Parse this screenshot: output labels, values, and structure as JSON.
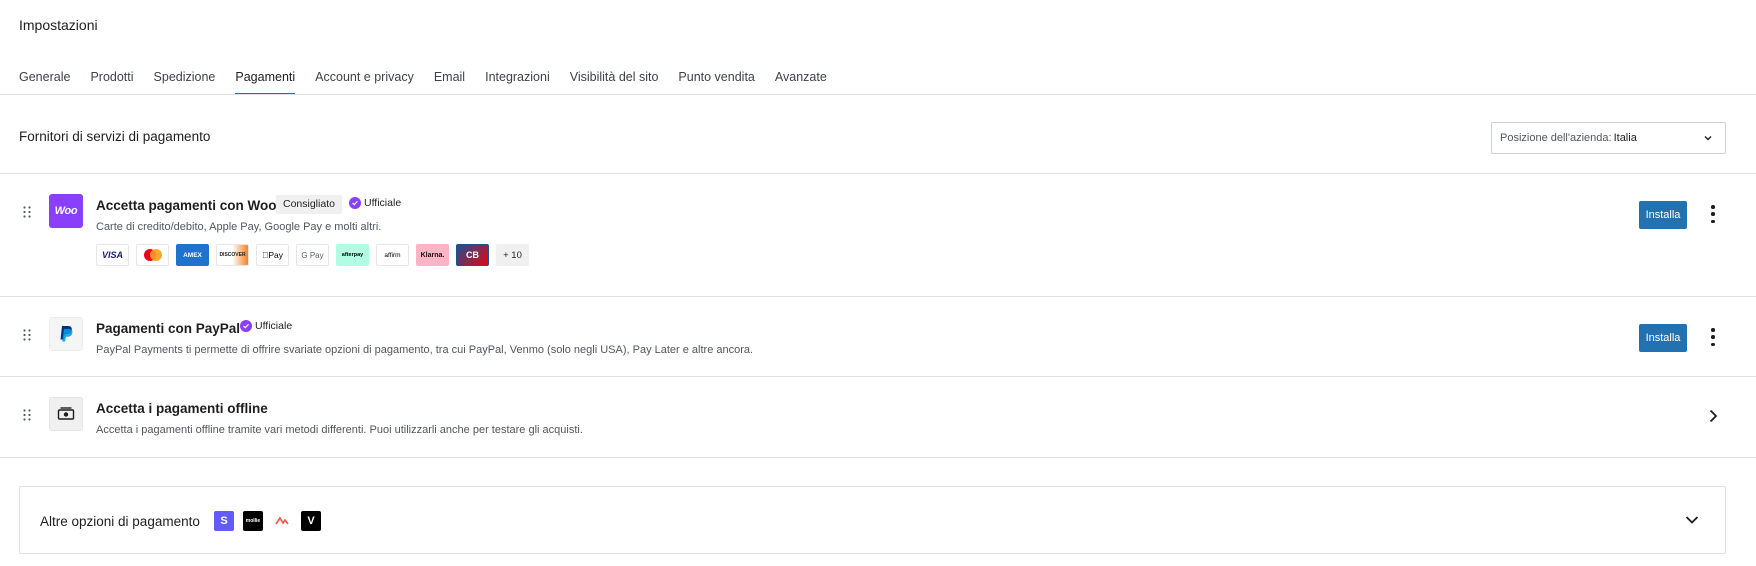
{
  "page": {
    "title": "Impostazioni"
  },
  "tabs": [
    {
      "label": "Generale",
      "active": false
    },
    {
      "label": "Prodotti",
      "active": false
    },
    {
      "label": "Spedizione",
      "active": false
    },
    {
      "label": "Pagamenti",
      "active": true
    },
    {
      "label": "Account e privacy",
      "active": false
    },
    {
      "label": "Email",
      "active": false
    },
    {
      "label": "Integrazioni",
      "active": false
    },
    {
      "label": "Visibilità del sito",
      "active": false
    },
    {
      "label": "Punto vendita",
      "active": false
    },
    {
      "label": "Avanzate",
      "active": false
    }
  ],
  "section": {
    "title": "Fornitori di servizi di pagamento",
    "location_label": "Posizione dell'azienda:",
    "location_value": "Italia"
  },
  "providers": [
    {
      "logo_text": "Woo",
      "title": "Accetta pagamenti con Woo",
      "badge_recommended": "Consigliato",
      "badge_official": "Ufficiale",
      "description": "Carte di credito/debito, Apple Pay, Google Pay e molti altri.",
      "install_label": "Installa"
    },
    {
      "title": "Pagamenti con PayPal",
      "badge_official": "Ufficiale",
      "description": "PayPal Payments ti permette di offrire svariate opzioni di pagamento, tra cui PayPal, Venmo (solo negli USA), Pay Later e altre ancora.",
      "install_label": "Installa"
    },
    {
      "title": "Accetta i pagamenti offline",
      "description": "Accetta i pagamenti offline tramite vari metodi differenti. Puoi utilizzarli anche per testare gli acquisti."
    }
  ],
  "payment_methods": [
    {
      "name": "visa",
      "text": "VISA"
    },
    {
      "name": "mastercard",
      "text": ""
    },
    {
      "name": "amex",
      "text": "AMEX"
    },
    {
      "name": "discover",
      "text": "DISCOVER"
    },
    {
      "name": "apple-pay",
      "text": "Pay"
    },
    {
      "name": "google-pay",
      "text": "G Pay"
    },
    {
      "name": "afterpay",
      "text": "afterpay"
    },
    {
      "name": "affirm",
      "text": "affirm"
    },
    {
      "name": "klarna",
      "text": "Klarna."
    },
    {
      "name": "cartes-bancaires",
      "text": "CB"
    }
  ],
  "payment_methods_more": "+ 10",
  "other": {
    "title": "Altre opzioni di pagamento",
    "logos": [
      {
        "name": "stripe",
        "text": "S"
      },
      {
        "name": "mollie",
        "text": "mollie"
      },
      {
        "name": "airwallex",
        "text": ""
      },
      {
        "name": "viva",
        "text": "V"
      }
    ]
  },
  "colors": {
    "accent": "#2271b1",
    "woo_purple": "#8a3ffc",
    "border": "#e0e0e0"
  }
}
